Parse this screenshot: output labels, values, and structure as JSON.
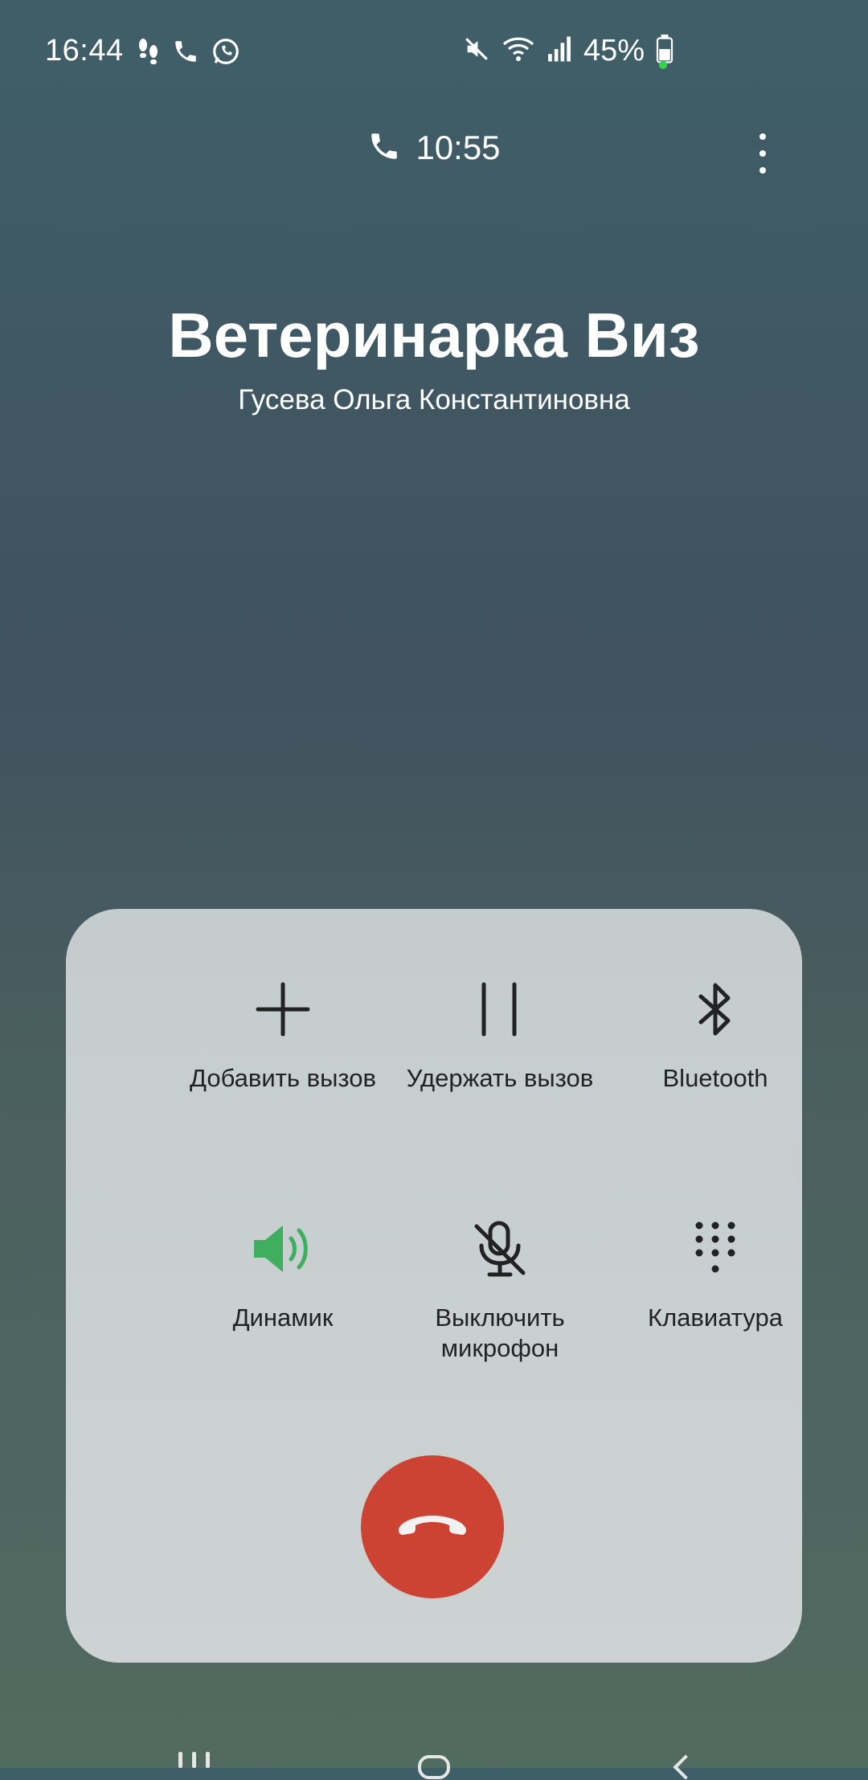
{
  "status_bar": {
    "time": "16:44",
    "battery": "45%",
    "left_icons": [
      "footsteps-icon",
      "phone-icon",
      "whatsapp-icon"
    ],
    "right_icons": [
      "mute-icon",
      "wifi-icon",
      "signal-icon",
      "battery-icon"
    ]
  },
  "call": {
    "duration": "10:55",
    "contact_name": "Ветеринарка Виз",
    "contact_subtitle": "Гусева Ольга Константиновна"
  },
  "controls": {
    "add_call": "Добавить вызов",
    "hold_call": "Удержать вызов",
    "bluetooth": "Bluetooth",
    "speaker": "Динамик",
    "mute_mic": "Выключить\nмикрофон",
    "keypad": "Клавиатура"
  },
  "colors": {
    "speaker_active": "#3fae5e",
    "end_call": "#cc4334",
    "panel_bg": "#c9cfd0"
  }
}
